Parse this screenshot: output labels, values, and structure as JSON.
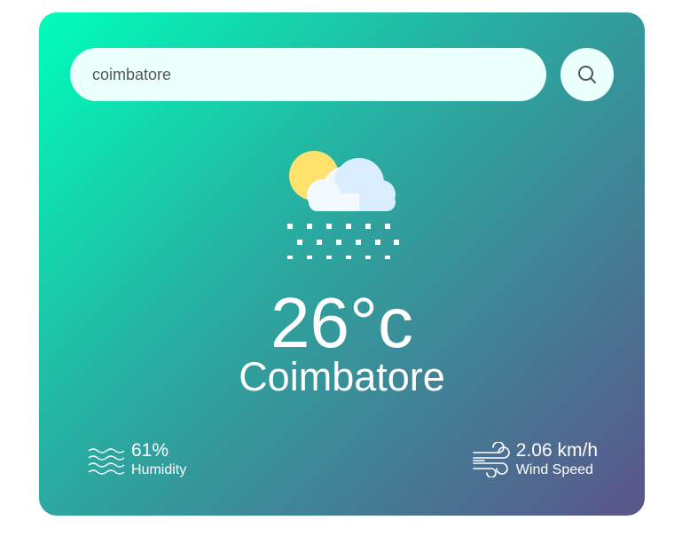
{
  "search": {
    "value": "coimbatore",
    "button_icon": "search-icon"
  },
  "weather": {
    "icon": "sun-cloud-snow-icon",
    "temperature": "26°c",
    "city": "Coimbatore"
  },
  "humidity": {
    "icon": "humidity-waves-icon",
    "value": "61%",
    "label": "Humidity"
  },
  "wind": {
    "icon": "wind-icon",
    "value": "2.06 km/h",
    "label": "Wind Speed"
  },
  "colors": {
    "gradient_start": "#00feba",
    "gradient_end": "#5b548a",
    "input_background": "#ebfffc",
    "text": "#ffffff"
  }
}
